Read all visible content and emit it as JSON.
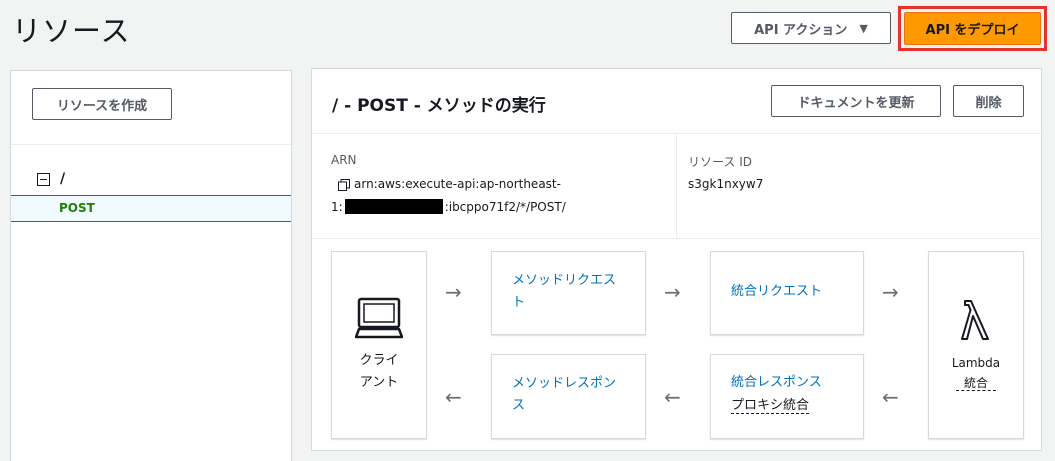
{
  "page": {
    "title": "リソース"
  },
  "header": {
    "api_action_label": "API アクション",
    "deploy_label": "API をデプロイ"
  },
  "colors": {
    "accent": "#ff9900",
    "link": "#0073bb",
    "method": "#1d8102",
    "highlight_border": "#e5322a"
  },
  "left_panel": {
    "create_resource_label": "リソースを作成",
    "tree": {
      "root_label": "/",
      "method_label": "POST"
    }
  },
  "method_panel": {
    "title": "/ - POST - メソッドの実行",
    "update_doc_label": "ドキュメントを更新",
    "delete_label": "削除",
    "arn_label": "ARN",
    "arn_line1": "arn:aws:execute-api:ap-northeast-",
    "arn_line2_prefix": "1:",
    "arn_line2_suffix": ":ibcppo71f2/*/POST/",
    "resource_id_label": "リソース ID",
    "resource_id_value": "s3gk1nxyw7"
  },
  "flow": {
    "client_line1": "クライ",
    "client_line2": "アント",
    "method_request_line1": "メソッドリクエス",
    "method_request_line2": "ト",
    "integration_request": "統合リクエスト",
    "method_response_line1": "メソッドレスポン",
    "method_response_line2": "ス",
    "integration_response": "統合レスポンス",
    "integration_response_sub": "プロキシ統合",
    "lambda_line1": "Lambda",
    "lambda_line2": "統合",
    "arrow_right": "→",
    "arrow_left": "←",
    "icons": [
      "computer-icon",
      "lambda-icon",
      "copy-icon"
    ]
  }
}
